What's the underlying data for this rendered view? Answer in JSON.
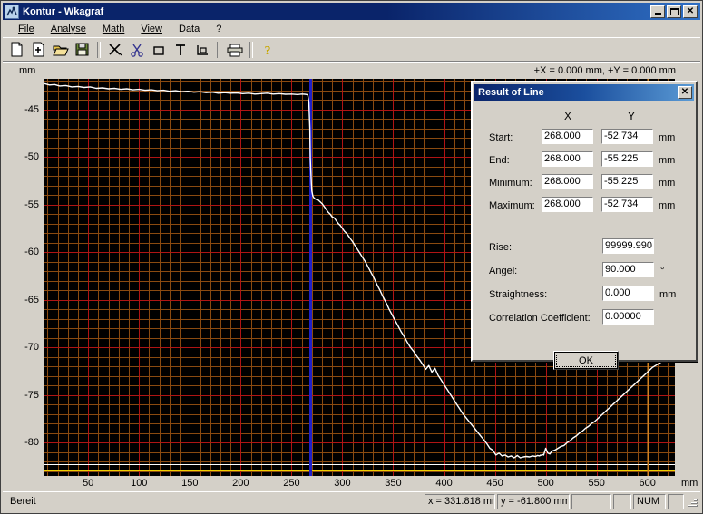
{
  "window": {
    "title": "Kontur - Wkagraf",
    "icon": "app-icon",
    "minimize": "_",
    "maximize": "□",
    "close": "×"
  },
  "menu": {
    "items": [
      {
        "label": "File",
        "accel": "F"
      },
      {
        "label": "Analyse",
        "accel": "A"
      },
      {
        "label": "Math",
        "accel": "M"
      },
      {
        "label": "View",
        "accel": "V"
      },
      {
        "label": "Data",
        "accel": "D"
      },
      {
        "label": "?",
        "accel": ""
      }
    ]
  },
  "toolbar": {
    "buttons": [
      {
        "name": "new-file-icon",
        "title": "New"
      },
      {
        "name": "add-file-icon",
        "title": "Add"
      },
      {
        "name": "open-folder-icon",
        "title": "Open"
      },
      {
        "name": "save-disk-icon",
        "title": "Save"
      },
      {
        "name": "separator",
        "title": ""
      },
      {
        "name": "cross-marker-icon",
        "title": "Cross"
      },
      {
        "name": "scissors-icon",
        "title": "Cut"
      },
      {
        "name": "rectangle-icon",
        "title": "Rectangle"
      },
      {
        "name": "text-tool-icon",
        "title": "Text"
      },
      {
        "name": "corner-axis-icon",
        "title": "Axis"
      },
      {
        "name": "separator",
        "title": ""
      },
      {
        "name": "printer-icon",
        "title": "Print"
      },
      {
        "name": "separator",
        "title": ""
      },
      {
        "name": "help-question-icon",
        "title": "Help"
      }
    ]
  },
  "graph": {
    "y_unit": "mm",
    "x_unit": "mm",
    "cursor_readout": "+X = 0.000 mm, +Y = 0.000 mm"
  },
  "dialog": {
    "title": "Result of Line",
    "close": "✕",
    "columns": {
      "x": "X",
      "y": "Y"
    },
    "rows": [
      {
        "label": "Start:",
        "x": "268.000",
        "y": "-52.734",
        "unit": "mm"
      },
      {
        "label": "End:",
        "x": "268.000",
        "y": "-55.225",
        "unit": "mm"
      },
      {
        "label": "Minimum:",
        "x": "268.000",
        "y": "-55.225",
        "unit": "mm"
      },
      {
        "label": "Maximum:",
        "x": "268.000",
        "y": "-52.734",
        "unit": "mm"
      }
    ],
    "stats": [
      {
        "label": "Rise:",
        "value": "99999.990",
        "unit": ""
      },
      {
        "label": "Angel:",
        "value": "90.000",
        "unit": "°"
      },
      {
        "label": "Straightness:",
        "value": "0.000",
        "unit": "mm"
      },
      {
        "label": "Correlation Coefficient:",
        "value": "0.00000",
        "unit": ""
      }
    ],
    "ok_label": "OK"
  },
  "statusbar": {
    "message": "Bereit",
    "x_readout": "x = 331.818 mm",
    "y_readout": "y = -61.800 mm",
    "pane3": "",
    "pane4": "",
    "num": "NUM",
    "pane6": ""
  },
  "chart_data": {
    "type": "line",
    "title": "",
    "xlabel": "mm",
    "ylabel": "mm",
    "xlim": [
      7,
      627
    ],
    "ylim": [
      -83.5,
      -41.8
    ],
    "xticks": [
      50,
      100,
      150,
      200,
      250,
      300,
      350,
      400,
      450,
      500,
      550,
      600
    ],
    "xticklabels": [
      "50",
      "100",
      "150",
      "200",
      "250",
      "300",
      "350",
      "400",
      "450",
      "500",
      "550",
      "600"
    ],
    "yticks": [
      -45,
      -50,
      -55,
      -60,
      -65,
      -70,
      -75,
      -80
    ],
    "yticklabels": [
      "-45",
      "-50",
      "-55",
      "-60",
      "-65",
      "-70",
      "-75",
      "-80"
    ],
    "grid": true,
    "grid_minor_color": "#8a4a10",
    "grid_major_color": "#b01414",
    "background": "#000000",
    "series": [
      {
        "name": "profile",
        "color": "#ffffff",
        "x": [
          7,
          12,
          17,
          22,
          28,
          34,
          40,
          46,
          52,
          58,
          64,
          70,
          76,
          82,
          88,
          94,
          100,
          106,
          112,
          118,
          124,
          130,
          136,
          142,
          148,
          154,
          160,
          166,
          172,
          178,
          184,
          190,
          196,
          202,
          208,
          214,
          220,
          226,
          232,
          238,
          244,
          250,
          256,
          260,
          263,
          265,
          266,
          267,
          267.5,
          268,
          268.2,
          268.5,
          269,
          269.5,
          270,
          271,
          272,
          273,
          274,
          276,
          278,
          280,
          282,
          284,
          286,
          288,
          290,
          292,
          294,
          296,
          298,
          300,
          302,
          304,
          306,
          308,
          310,
          313,
          316,
          319,
          322,
          325,
          328,
          331,
          334,
          337,
          340,
          343,
          346,
          349,
          352,
          355,
          358,
          361,
          364,
          367,
          370,
          373,
          376,
          379,
          382,
          385,
          388,
          391,
          394,
          397,
          400,
          403,
          406,
          409,
          412,
          415,
          418,
          421,
          424,
          427,
          430,
          433,
          436,
          439,
          442,
          445,
          448,
          451,
          454,
          457,
          460,
          463,
          466,
          469,
          472,
          475,
          478,
          481,
          484,
          487,
          490,
          492,
          494,
          495,
          496,
          497,
          498,
          500,
          502,
          504,
          506,
          509,
          512,
          515,
          518,
          521,
          524,
          527,
          530,
          533,
          536,
          539,
          542,
          545,
          548,
          551,
          554,
          557,
          560,
          563,
          566,
          569,
          572,
          575,
          578,
          581,
          584,
          587,
          590,
          593,
          596,
          599,
          602,
          605,
          608,
          611,
          614,
          617,
          620,
          623,
          626
        ],
        "y": [
          -42.3,
          -42.45,
          -42.4,
          -42.55,
          -42.5,
          -42.65,
          -42.6,
          -42.7,
          -42.65,
          -42.8,
          -42.75,
          -42.85,
          -42.8,
          -42.9,
          -42.85,
          -42.95,
          -42.9,
          -43.0,
          -42.95,
          -43.05,
          -43.0,
          -43.1,
          -43.05,
          -43.15,
          -43.1,
          -43.2,
          -43.15,
          -43.25,
          -43.2,
          -43.3,
          -43.25,
          -43.3,
          -43.28,
          -43.35,
          -43.3,
          -43.4,
          -43.35,
          -43.3,
          -43.4,
          -43.35,
          -43.42,
          -43.4,
          -43.45,
          -43.4,
          -43.42,
          -43.45,
          -43.5,
          -44.2,
          -45.5,
          -47.0,
          -48.6,
          -50.2,
          -51.6,
          -52.8,
          -53.6,
          -54.1,
          -54.3,
          -54.4,
          -54.45,
          -54.5,
          -54.7,
          -54.9,
          -55.2,
          -55.5,
          -55.8,
          -56.0,
          -56.3,
          -56.4,
          -56.7,
          -57.0,
          -57.2,
          -57.5,
          -57.8,
          -58.0,
          -58.3,
          -58.6,
          -58.9,
          -59.4,
          -59.9,
          -60.4,
          -60.9,
          -61.5,
          -62.1,
          -62.7,
          -63.4,
          -64.0,
          -64.7,
          -65.3,
          -66.0,
          -66.6,
          -67.2,
          -67.8,
          -68.4,
          -68.9,
          -69.5,
          -70.0,
          -70.4,
          -70.9,
          -71.3,
          -71.8,
          -72.3,
          -71.9,
          -72.6,
          -72.2,
          -72.9,
          -73.4,
          -73.9,
          -74.4,
          -74.9,
          -75.4,
          -75.9,
          -76.4,
          -76.9,
          -77.3,
          -77.7,
          -78.1,
          -78.5,
          -78.9,
          -79.3,
          -79.7,
          -80.1,
          -80.6,
          -80.8,
          -81.3,
          -81.1,
          -81.4,
          -81.3,
          -81.5,
          -81.4,
          -81.6,
          -81.35,
          -81.6,
          -81.5,
          -81.45,
          -81.5,
          -81.4,
          -81.45,
          -81.35,
          -81.4,
          -81.3,
          -81.35,
          -81.25,
          -81.3,
          -80.6,
          -81.1,
          -81.2,
          -80.9,
          -80.8,
          -80.6,
          -80.4,
          -80.3,
          -80.0,
          -79.8,
          -79.5,
          -79.3,
          -79.0,
          -78.8,
          -78.5,
          -78.3,
          -78.0,
          -77.8,
          -77.5,
          -77.2,
          -76.9,
          -76.6,
          -76.3,
          -76.0,
          -75.7,
          -75.4,
          -75.1,
          -74.8,
          -74.5,
          -74.2,
          -73.9,
          -73.6,
          -73.3,
          -73.0,
          -72.7,
          -72.4,
          -72.1,
          -71.9,
          -71.7,
          -71.5,
          -71.4,
          -71.3,
          -71.25
        ]
      }
    ],
    "markers": {
      "vertical_cursor_blue": {
        "x": 268,
        "color": "#2020c8"
      },
      "vertical_cursor_orange": {
        "x": 600,
        "color": "#d08020"
      },
      "horizontal_line_top": {
        "y": -42.1,
        "color": "#f0d000"
      },
      "horizontal_line_bottom": {
        "y": -82.9,
        "color": "#f0d000"
      },
      "horizontal_line_white": {
        "y": -82.3,
        "color": "#ffffff"
      }
    }
  }
}
